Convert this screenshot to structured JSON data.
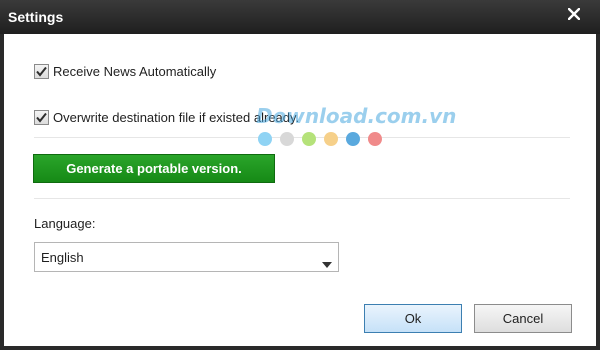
{
  "window": {
    "title": "Settings"
  },
  "options": {
    "receive_news_label": "Receive News Automatically",
    "receive_news_checked": true,
    "overwrite_label": "Overwrite destination file if existed already.",
    "overwrite_checked": true
  },
  "portable_button_label": "Generate a portable version.",
  "language": {
    "label": "Language:",
    "selected": "English"
  },
  "buttons": {
    "ok_label": "Ok",
    "cancel_label": "Cancel"
  },
  "watermark": {
    "text": "Download.com.vn",
    "dot_colors": [
      "#8fd3f4",
      "#d8d8d8",
      "#b5e27a",
      "#f6d08a",
      "#5aa9de",
      "#f08a8a"
    ]
  },
  "colors": {
    "titlebar": "#2a2a2a",
    "portable_button": "#1e981e",
    "ok_button": "#c6e1f8"
  }
}
